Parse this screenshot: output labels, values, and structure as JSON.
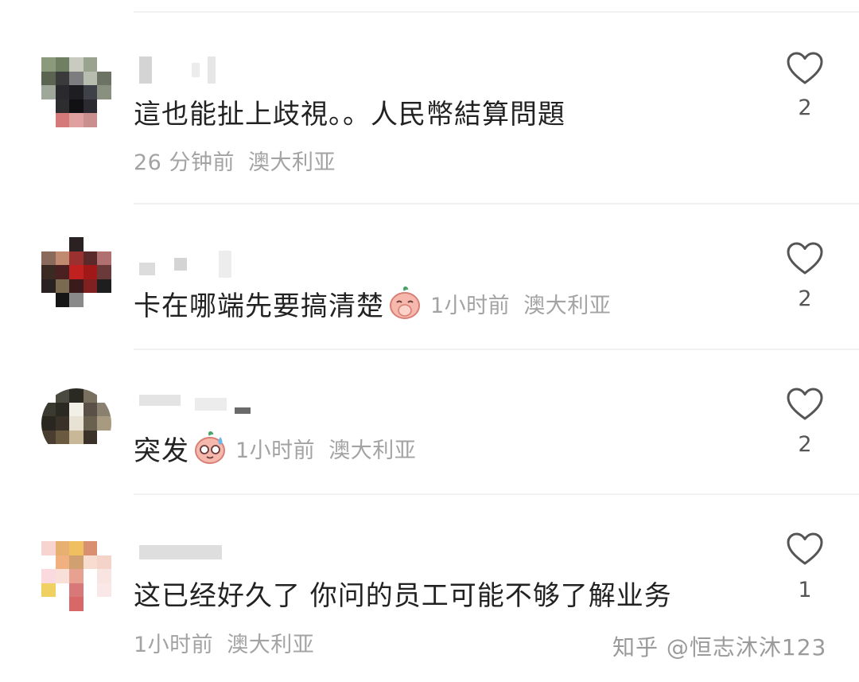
{
  "comments": [
    {
      "text": "這也能扯上歧視。。人民幣結算問題",
      "time": "26 分钟前",
      "location": "澳大利亚",
      "likes": "2",
      "emoji": ""
    },
    {
      "text": "卡在哪端先要搞清楚",
      "time": "1小时前",
      "location": "澳大利亚",
      "likes": "2",
      "emoji": "covering-mouth-emoji"
    },
    {
      "text": "突发",
      "time": "1小时前",
      "location": "澳大利亚",
      "likes": "2",
      "emoji": "sweating-glasses-emoji"
    },
    {
      "text": "这已经好久了 你问的员工可能不够了解业务",
      "time": "1小时前",
      "location": "澳大利亚",
      "likes": "1",
      "emoji": ""
    }
  ],
  "watermark": "知乎 @恒志沐沐123",
  "icons": {
    "like": "heart-outline-icon"
  },
  "colors": {
    "text": "#222222",
    "meta": "#a3a3a3",
    "count": "#555555",
    "heart": "#555555"
  }
}
